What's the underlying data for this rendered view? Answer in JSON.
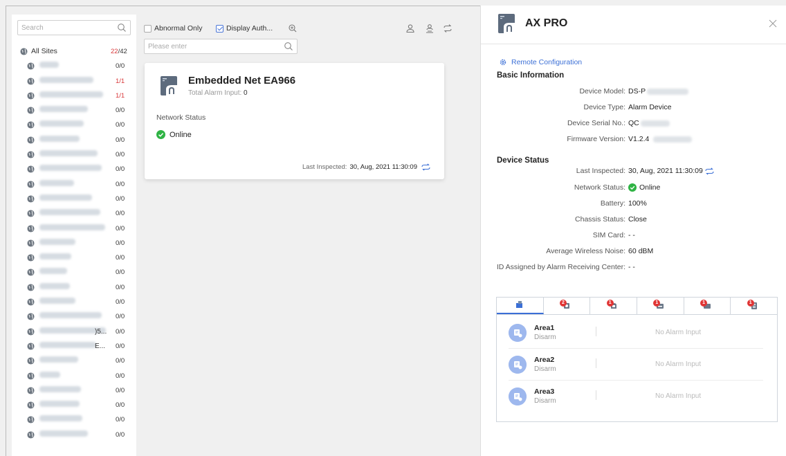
{
  "sidebar": {
    "search_placeholder": "Search",
    "root": {
      "label": "All Sites",
      "abnormal": "22",
      "total": "/42"
    },
    "sites": [
      {
        "count": "0/0",
        "abnormal": false
      },
      {
        "count": "1/1",
        "abnormal": true
      },
      {
        "count": "1/1",
        "abnormal": true
      },
      {
        "count": "0/0",
        "abnormal": false
      },
      {
        "count": "0/0",
        "abnormal": false
      },
      {
        "count": "0/0",
        "abnormal": false
      },
      {
        "count": "0/0",
        "abnormal": false
      },
      {
        "count": "0/0",
        "abnormal": false
      },
      {
        "count": "0/0",
        "abnormal": false
      },
      {
        "count": "0/0",
        "abnormal": false
      },
      {
        "count": "0/0",
        "abnormal": false
      },
      {
        "count": "0/0",
        "abnormal": false
      },
      {
        "count": "0/0",
        "abnormal": false
      },
      {
        "count": "0/0",
        "abnormal": false
      },
      {
        "count": "0/0",
        "abnormal": false
      },
      {
        "count": "0/0",
        "abnormal": false
      },
      {
        "count": "0/0",
        "abnormal": false
      },
      {
        "count": "0/0",
        "abnormal": false
      },
      {
        "count": "0/0",
        "abnormal": false,
        "tail": ")5..."
      },
      {
        "count": "0/0",
        "abnormal": false,
        "tail": "E..."
      },
      {
        "count": "0/0",
        "abnormal": false
      },
      {
        "count": "0/0",
        "abnormal": false
      },
      {
        "count": "0/0",
        "abnormal": false
      },
      {
        "count": "0/0",
        "abnormal": false
      },
      {
        "count": "0/0",
        "abnormal": false
      },
      {
        "count": "0/0",
        "abnormal": false
      }
    ]
  },
  "toolbar": {
    "abnormal_only": "Abnormal Only",
    "display_auth": "Display Auth...",
    "input_placeholder": "Please enter"
  },
  "card": {
    "title": "Embedded Net EA966",
    "total_alarm_label": "Total Alarm Input:",
    "total_alarm_value": "0",
    "network_status_label": "Network Status",
    "network_status_value": "Online",
    "last_inspected_label": "Last Inspected:",
    "last_inspected_value": "30, Aug, 2021 11:30:09"
  },
  "panel": {
    "title": "AX PRO",
    "remote_config": "Remote Configuration",
    "basic_info_title": "Basic Information",
    "device_model_label": "Device Model:",
    "device_model_value": "DS-P",
    "device_type_label": "Device Type:",
    "device_type_value": "Alarm Device",
    "serial_label": "Device Serial No.:",
    "serial_value": "QC",
    "firmware_label": "Firmware Version:",
    "firmware_value": "V1.2.4",
    "status_title": "Device Status",
    "last_inspected_label": "Last Inspected:",
    "last_inspected_value": "30, Aug, 2021 11:30:09",
    "network_status_label": "Network Status:",
    "network_status_value": "Online",
    "battery_label": "Battery:",
    "battery_value": "100%",
    "chassis_label": "Chassis Status:",
    "chassis_value": "Close",
    "sim_label": "SIM Card:",
    "sim_value": "- -",
    "noise_label": "Average Wireless Noise:",
    "noise_value": "60 dBM",
    "arc_id_label": "ID Assigned by Alarm Receiving Center:",
    "arc_id_value": "- -",
    "tabs": [
      {
        "icon": "area-icon",
        "badge": ""
      },
      {
        "icon": "zone-icon",
        "badge": "2"
      },
      {
        "icon": "siren-icon",
        "badge": "1"
      },
      {
        "icon": "repeater-icon",
        "badge": "1"
      },
      {
        "icon": "output-icon",
        "badge": "1"
      },
      {
        "icon": "keypad-icon",
        "badge": "1"
      }
    ],
    "areas": [
      {
        "name": "Area1",
        "status": "Disarm",
        "alarm_input": "No Alarm Input"
      },
      {
        "name": "Area2",
        "status": "Disarm",
        "alarm_input": "No Alarm Input"
      },
      {
        "name": "Area3",
        "status": "Disarm",
        "alarm_input": "No Alarm Input"
      }
    ]
  },
  "colors": {
    "accent": "#3b6fd6",
    "alarm": "#d9383a",
    "online": "#2fb344"
  }
}
